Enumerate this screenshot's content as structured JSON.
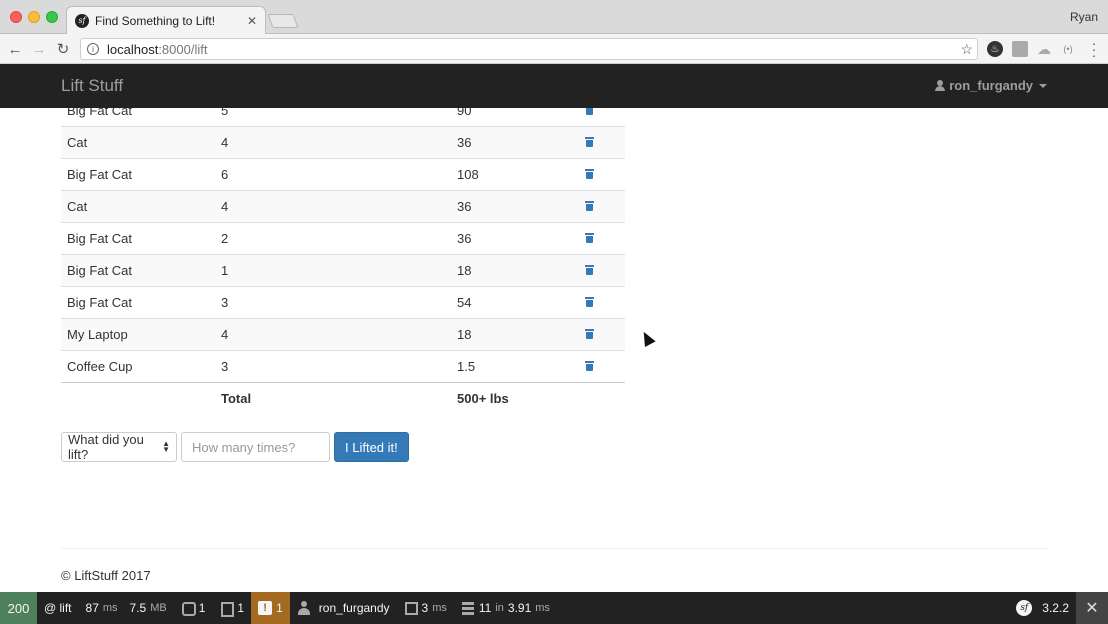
{
  "browser": {
    "tab_title": "Find Something to Lift!",
    "tab_close": "✕",
    "profile_name": "Ryan",
    "url_host": "localhost",
    "url_path": ":8000/lift"
  },
  "navbar": {
    "brand": "Lift Stuff",
    "user": "ron_furgandy"
  },
  "table": {
    "rows": [
      {
        "item": "Big Fat Cat",
        "reps": "5",
        "weight": "90"
      },
      {
        "item": "Cat",
        "reps": "4",
        "weight": "36"
      },
      {
        "item": "Big Fat Cat",
        "reps": "6",
        "weight": "108"
      },
      {
        "item": "Cat",
        "reps": "4",
        "weight": "36"
      },
      {
        "item": "Big Fat Cat",
        "reps": "2",
        "weight": "36"
      },
      {
        "item": "Big Fat Cat",
        "reps": "1",
        "weight": "18"
      },
      {
        "item": "Big Fat Cat",
        "reps": "3",
        "weight": "54"
      },
      {
        "item": "My Laptop",
        "reps": "4",
        "weight": "18"
      },
      {
        "item": "Coffee Cup",
        "reps": "3",
        "weight": "1.5"
      }
    ],
    "total_label": "Total",
    "total_value": "500+ lbs"
  },
  "form": {
    "select_value": "What did you lift?",
    "reps_placeholder": "How many times?",
    "submit_label": "I Lifted it!"
  },
  "footer": {
    "copyright": "© LiftStuff 2017"
  },
  "toolbar": {
    "status_code": "200",
    "route": "@ lift",
    "time_value": "87",
    "time_unit": "ms",
    "memory_value": "7.5",
    "memory_unit": "MB",
    "requests_count": "1",
    "forms_count": "1",
    "warnings_count": "1",
    "user": "ron_furgandy",
    "twig_value": "3",
    "twig_unit": "ms",
    "db_queries": "11",
    "db_in": "in",
    "db_time": "3.91",
    "db_unit": "ms",
    "version": "3.2.2",
    "close": "✕"
  },
  "icons": {
    "favicon": "sf",
    "info": "i",
    "excl": "!",
    "sf_logo": "sf"
  },
  "colors": {
    "navbar": "#222222",
    "primary_button": "#337ab7",
    "status_ok": "#4f805d",
    "warning": "#a46a1f"
  }
}
